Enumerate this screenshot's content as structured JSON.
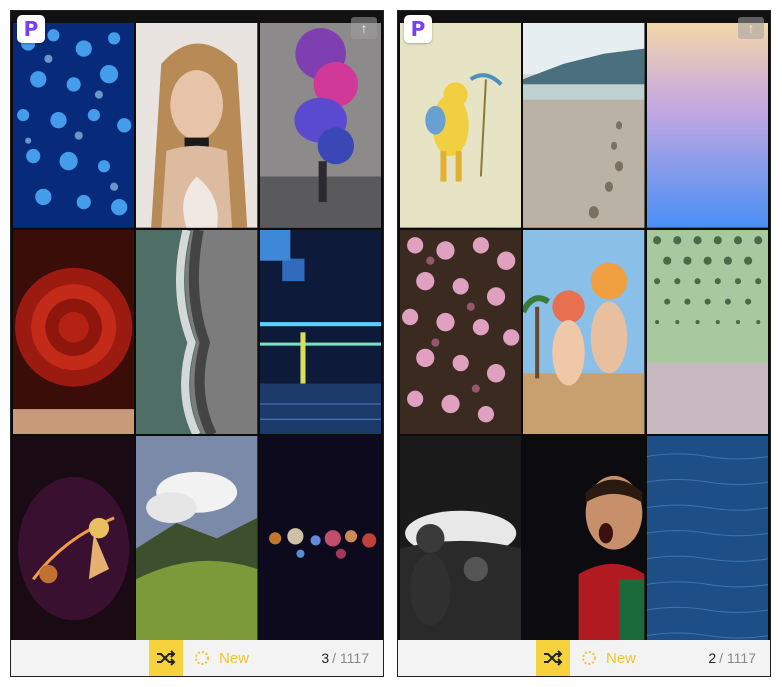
{
  "screens": [
    {
      "logo_letter": "P",
      "upload_icon": "↑",
      "new_label": "New",
      "counter": {
        "current": "3",
        "separator": "/",
        "total": "1117"
      },
      "tiles": [
        "jellyfish",
        "woman-portrait",
        "purple-smoke",
        "red-rose",
        "beach-aerial",
        "neon-abstract",
        "fire-dancers",
        "green-mountains",
        "bokeh-lights"
      ]
    },
    {
      "logo_letter": "P",
      "upload_icon": "↑",
      "new_label": "New",
      "counter": {
        "current": "2",
        "separator": "/",
        "total": "1117"
      },
      "tiles": [
        "yellow-cartoon",
        "beach-footprints",
        "pastel-gradient",
        "pink-flowers",
        "anime-girls",
        "halftone-dots",
        "car-interior",
        "cristiano-ronaldo",
        "ocean-water"
      ]
    }
  ]
}
